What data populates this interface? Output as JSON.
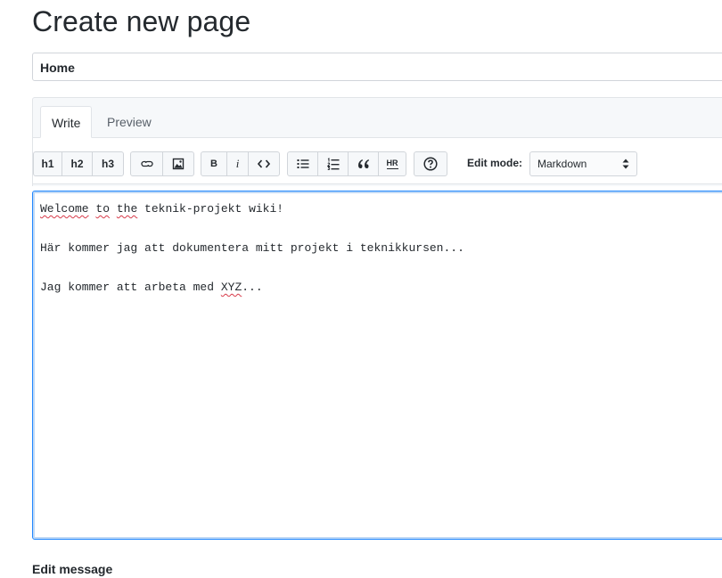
{
  "header": {
    "title": "Create new page"
  },
  "page_title_input": {
    "value": "Home"
  },
  "tabs": [
    {
      "label": "Write",
      "selected": true
    },
    {
      "label": "Preview",
      "selected": false
    }
  ],
  "toolbar": {
    "headings": [
      "h1",
      "h2",
      "h3"
    ],
    "bold_label": "B",
    "italic_label": "i",
    "hr_label": "HR",
    "icons": [
      "link-icon",
      "image-icon",
      "code-icon",
      "unordered-list-icon",
      "ordered-list-icon",
      "quote-icon",
      "help-icon"
    ],
    "edit_mode_label": "Edit mode:",
    "edit_mode_value": "Markdown"
  },
  "editor": {
    "lines": [
      "Welcome to the teknik-projekt wiki!",
      "",
      "Här kommer jag att dokumentera mitt projekt i teknikkursen...",
      "",
      "Jag kommer att arbeta med XYZ..."
    ],
    "spellcheck_words": [
      "Welcome",
      "to",
      "the",
      "XYZ"
    ]
  },
  "footer": {
    "edit_message_label": "Edit message"
  },
  "colors": {
    "focus_border": "#2188ff",
    "spellcheck": "#d73a49",
    "toolbar_bg": "#f6f8fa"
  }
}
